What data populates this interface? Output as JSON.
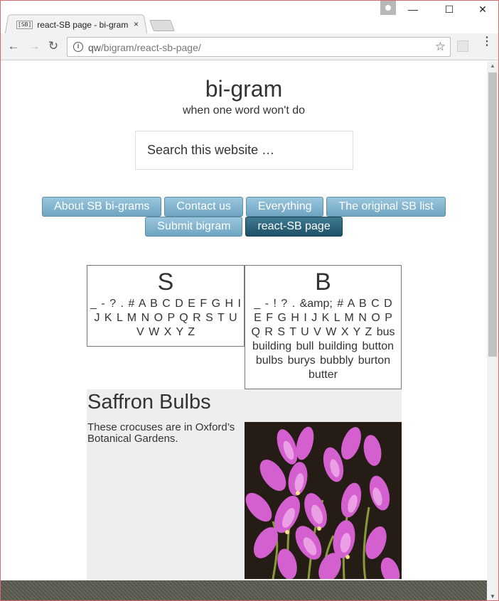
{
  "browser": {
    "tab_favicon": "[SB]",
    "tab_title": "react-SB page - bi-gram",
    "tab_close": "×",
    "url_host": "qw",
    "url_path": "/bigram/react-sb-page/",
    "icons": [
      "back-arrow-icon",
      "forward-arrow-icon",
      "reload-icon",
      "info-icon",
      "star-icon",
      "extension-icon",
      "menu-icon",
      "profile-icon",
      "minimize-icon",
      "maximize-icon",
      "close-icon"
    ]
  },
  "site": {
    "title": "bi-gram",
    "description": "when one word won't do",
    "search_placeholder": "Search this website …"
  },
  "menu": {
    "row1": [
      "About SB bi-grams",
      "Contact us",
      "Everything",
      "The original SB list"
    ],
    "row2": [
      "Submit bigram",
      "react-SB page"
    ],
    "active": "react-SB page"
  },
  "boxes": {
    "s": {
      "letter": "S",
      "list": "_ - ? . # A B C D E F G H I J K L M N O P Q R S T U V W X Y Z"
    },
    "b": {
      "letter": "B",
      "list": "_ - ! ? . &amp; # A B C D E F G H I J K L M N O P Q R S T U V W X Y Z bus building bull building button bulbs burys bubbly burton butter"
    }
  },
  "post": {
    "title": "Saffron Bulbs",
    "text": "These crocuses are in Oxford’s Botanical Gardens.",
    "image": "purple crocus flowers photo"
  },
  "colors": {
    "menu_button": "#7fb2cf",
    "menu_active": "#2b627a",
    "post_bg": "#eeeeee",
    "window_border": "#d06b6f"
  }
}
